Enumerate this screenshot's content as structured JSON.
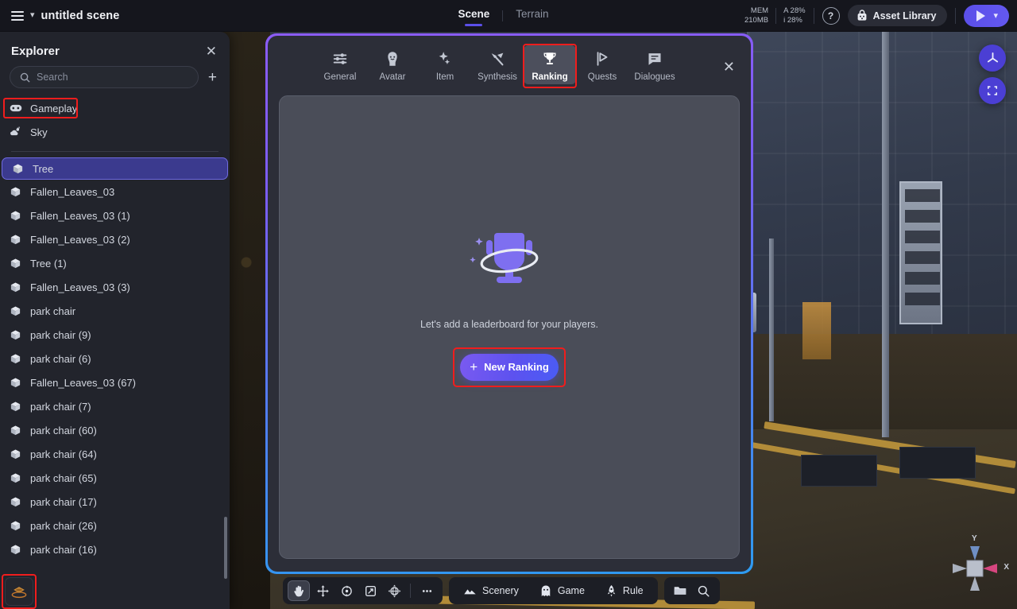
{
  "topbar": {
    "menu_icon": "hamburger-icon",
    "chevron_icon": "chevron-down-icon",
    "scene_title": "untitled scene",
    "view_tabs": [
      {
        "label": "Scene",
        "active": true
      },
      {
        "label": "Terrain",
        "active": false
      }
    ],
    "stats": {
      "mem_label": "MEM",
      "mem_value": "210MB",
      "audio_label": "A 28%",
      "info_label": "i 28%"
    },
    "help_icon": "question-mark-icon",
    "asset_library": {
      "label": "Asset Library",
      "icon": "lock-bag-icon"
    },
    "play": {
      "icon": "play-triangle-icon",
      "dropdown_icon": "chevron-down-icon"
    }
  },
  "explorer": {
    "title": "Explorer",
    "close_icon": "close-icon",
    "search": {
      "placeholder": "Search",
      "value": "",
      "icon": "search-icon"
    },
    "add_icon": "plus-icon",
    "system_rows": [
      {
        "label": "Gameplay",
        "icon": "gamepad-icon",
        "highlighted": true
      },
      {
        "label": "Sky",
        "icon": "cloud-sun-icon",
        "highlighted": false
      }
    ],
    "items": [
      {
        "label": "Tree",
        "selected": true
      },
      {
        "label": "Fallen_Leaves_03",
        "selected": false
      },
      {
        "label": "Fallen_Leaves_03 (1)",
        "selected": false
      },
      {
        "label": "Fallen_Leaves_03 (2)",
        "selected": false
      },
      {
        "label": "Tree (1)",
        "selected": false
      },
      {
        "label": "Fallen_Leaves_03 (3)",
        "selected": false
      },
      {
        "label": "park chair",
        "selected": false
      },
      {
        "label": "park chair (9)",
        "selected": false
      },
      {
        "label": "park chair (6)",
        "selected": false
      },
      {
        "label": "Fallen_Leaves_03 (67)",
        "selected": false
      },
      {
        "label": "park chair (7)",
        "selected": false
      },
      {
        "label": "park chair (60)",
        "selected": false
      },
      {
        "label": "park chair (64)",
        "selected": false
      },
      {
        "label": "park chair (65)",
        "selected": false
      },
      {
        "label": "park chair (17)",
        "selected": false
      },
      {
        "label": "park chair (26)",
        "selected": false
      },
      {
        "label": "park chair (16)",
        "selected": false
      }
    ]
  },
  "layers_button": {
    "icon": "layers-icon",
    "highlighted": true
  },
  "modal": {
    "border_colors": {
      "top": "#8b5cf6",
      "bottom": "#2e9bf0"
    },
    "close_icon": "close-icon",
    "tabs": [
      {
        "label": "General",
        "icon": "sliders-icon",
        "active": false
      },
      {
        "label": "Avatar",
        "icon": "avatar-head-icon",
        "active": false
      },
      {
        "label": "Item",
        "icon": "magic-wand-star-icon",
        "active": false
      },
      {
        "label": "Synthesis",
        "icon": "hammer-icon",
        "active": false
      },
      {
        "label": "Ranking",
        "icon": "trophy-icon",
        "active": true,
        "highlighted": true
      },
      {
        "label": "Quests",
        "icon": "flag-play-icon",
        "active": false
      },
      {
        "label": "Dialogues",
        "icon": "speech-bubble-icon",
        "active": false
      }
    ],
    "empty_state": {
      "illustration": "trophy-with-sparkles-icon",
      "message": "Let's add a leaderboard for your players.",
      "button": {
        "label": "New Ranking",
        "icon": "plus-icon",
        "highlighted": true
      }
    }
  },
  "bottombar": {
    "transform_tools": [
      {
        "name": "hand-tool",
        "icon": "hand-icon",
        "active": true
      },
      {
        "name": "move-tool",
        "icon": "move-arrows-icon",
        "active": false
      },
      {
        "name": "rotate-tool",
        "icon": "rotate-icon",
        "active": false
      },
      {
        "name": "scale-tool",
        "icon": "scale-arrow-icon",
        "active": false
      },
      {
        "name": "universal-tool",
        "icon": "globe-crosshair-icon",
        "active": false
      },
      {
        "name": "more-tools",
        "icon": "ellipsis-icon",
        "active": false
      }
    ],
    "categories": [
      {
        "label": "Scenery",
        "icon": "mountains-icon"
      },
      {
        "label": "Game",
        "icon": "ghost-icon"
      },
      {
        "label": "Rule",
        "icon": "rocket-icon"
      }
    ],
    "utilities": [
      {
        "name": "folder-button",
        "icon": "folder-icon"
      },
      {
        "name": "search-button",
        "icon": "search-icon"
      }
    ]
  },
  "right_buttons": [
    {
      "name": "axis-pivot-button",
      "icon": "tri-axis-icon"
    },
    {
      "name": "sync-view-button",
      "icon": "refresh-corners-icon"
    }
  ],
  "gizmo": {
    "y_label": "Y",
    "x_label": "X"
  },
  "accents": {
    "primary_purple": "#5b4fe9",
    "selection_blue": "#3b3a8e",
    "highlight_red": "#f01d1d",
    "panel_bg": "#22242c",
    "modal_bg": "#2c2e38",
    "empty_panel_bg": "#4a4d58"
  }
}
